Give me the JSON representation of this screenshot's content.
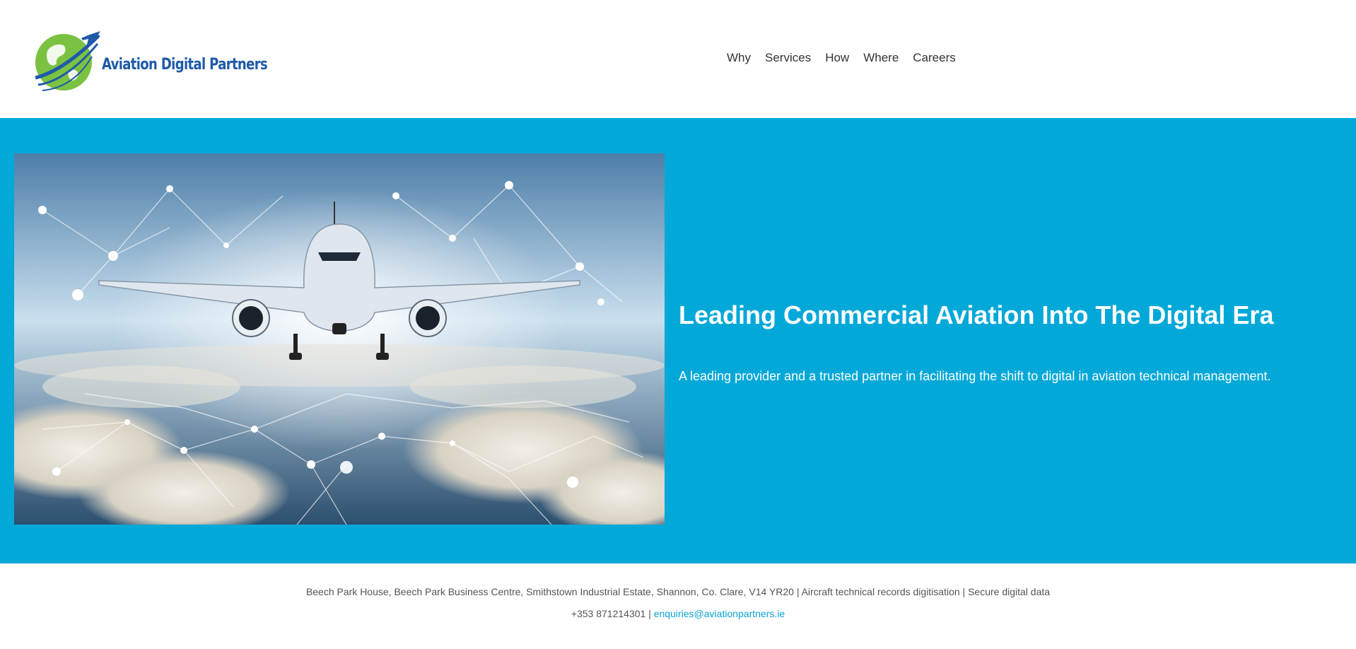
{
  "brand": {
    "name": "Aviation Digital Partners",
    "color": "#1e5aa8",
    "globe_color": "#7cc242"
  },
  "nav": {
    "items": [
      {
        "label": "Why"
      },
      {
        "label": "Services"
      },
      {
        "label": "How"
      },
      {
        "label": "Where"
      },
      {
        "label": "Careers"
      }
    ]
  },
  "hero": {
    "background": "#02a8d8",
    "title": "Leading Commercial Aviation Into The Digital Era",
    "subtitle": "A leading provider and a trusted partner in facilitating the shift to digital in aviation technical management.",
    "image_icon": "airplane-network-image"
  },
  "footer": {
    "address": "Beech Park House, Beech Park Business Centre, Smithstown Industrial Estate, Shannon, Co. Clare, V14 YR20 | Aircraft technical records digitisation | Secure digital data",
    "phone": "+353 871214301",
    "separator": "|",
    "email": "enquiries@aviationpartners.ie",
    "link_color": "#0aa2d4"
  }
}
